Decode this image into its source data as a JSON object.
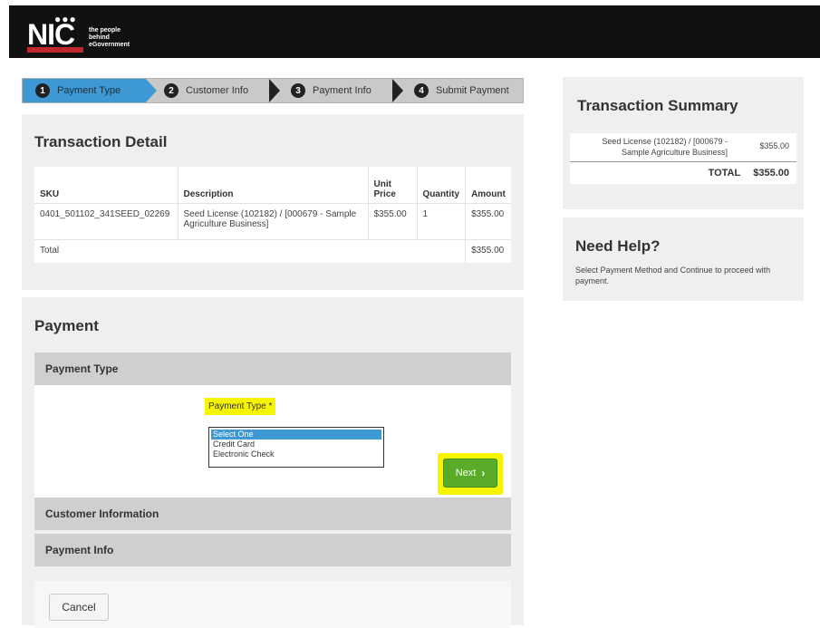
{
  "header": {
    "logo_text": "NIC",
    "logo_dots": "●●●",
    "tagline_1": "the people",
    "tagline_2": "behind",
    "tagline_3": "eGovernment"
  },
  "steps": [
    {
      "num": "1",
      "label": "Payment Type",
      "active": true
    },
    {
      "num": "2",
      "label": "Customer Info",
      "active": false
    },
    {
      "num": "3",
      "label": "Payment Info",
      "active": false
    },
    {
      "num": "4",
      "label": "Submit Payment",
      "active": false
    }
  ],
  "transaction_detail": {
    "title": "Transaction Detail",
    "columns": {
      "sku": "SKU",
      "description": "Description",
      "unit_price": "Unit Price",
      "quantity": "Quantity",
      "amount": "Amount"
    },
    "row": {
      "sku": "0401_501102_341SEED_02269",
      "description": "Seed License (102182) / [000679 - Sample Agriculture Business]",
      "unit_price": "$355.00",
      "quantity": "1",
      "amount": "$355.00"
    },
    "total_label": "Total",
    "total_amount": "$355.00"
  },
  "payment": {
    "title": "Payment",
    "section_payment_type": "Payment Type",
    "field_label": "Payment Type *",
    "options": [
      "Select One",
      "Credit Card",
      "Electronic Check"
    ],
    "selected_option": "Select One",
    "next_label": "Next",
    "next_arrow": "›",
    "section_customer_info": "Customer Information",
    "section_payment_info": "Payment Info",
    "cancel_label": "Cancel"
  },
  "summary": {
    "title": "Transaction Summary",
    "item_desc": "Seed License (102182) / [000679 - Sample Agriculture Business]",
    "item_amount": "$355.00",
    "total_label": "TOTAL",
    "total_amount": "$355.00"
  },
  "help": {
    "title": "Need Help?",
    "text": "Select Payment Method and Continue to proceed with payment."
  },
  "colors": {
    "active_step": "#3d98d4",
    "highlight": "#f6f400",
    "next_button": "#5aab2a"
  }
}
